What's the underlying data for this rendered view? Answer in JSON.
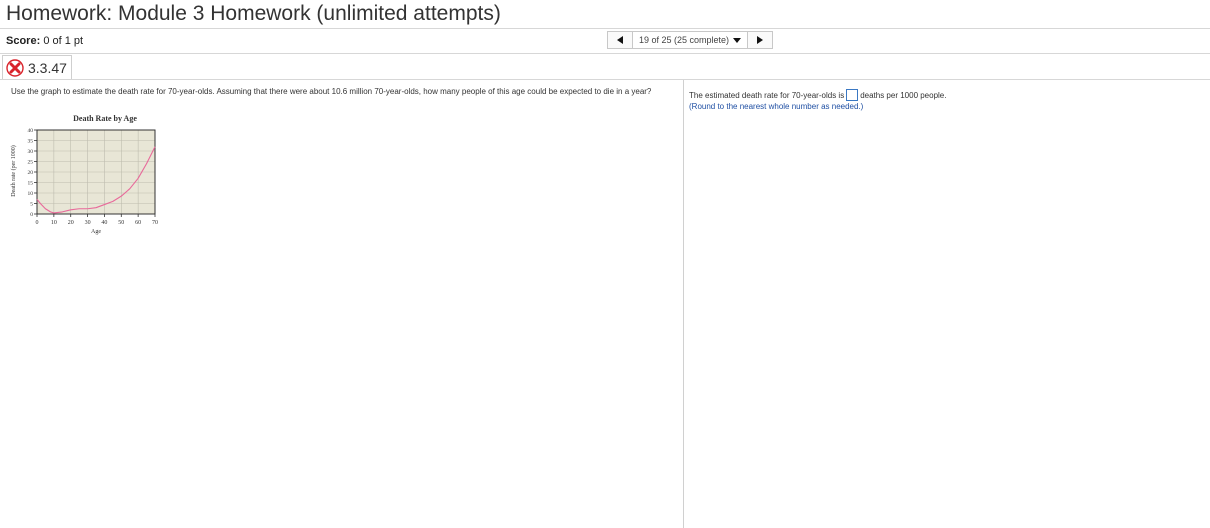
{
  "header": {
    "title": "Homework: Module 3 Homework (unlimited attempts)",
    "score_label": "Score:",
    "score_value": "0 of 1 pt"
  },
  "nav": {
    "position_text": "19 of 25 (25 complete)"
  },
  "question": {
    "number": "3.3.47",
    "status": "incorrect",
    "prompt": "Use the graph to estimate the death rate for 70-year-olds. Assuming that there were about 10.6 million 70-year-olds, how many people of this age could be expected to die in a year?"
  },
  "answer": {
    "before": "The estimated death rate for 70-year-olds is",
    "after": "deaths per 1000 people.",
    "hint": "(Round to the nearest whole number as needed.)",
    "input_value": ""
  },
  "colors": {
    "incorrect_red": "#d9232b",
    "plot_bg": "#e8e6d6",
    "curve": "#e8699a",
    "hint_blue": "#1f4fa3"
  },
  "chart_data": {
    "type": "line",
    "title": "Death Rate by Age",
    "xlabel": "Age",
    "ylabel": "Death rate (per 1000)",
    "xlim": [
      0,
      70
    ],
    "ylim": [
      0,
      40
    ],
    "x_ticks": [
      "0",
      "10",
      "20",
      "30",
      "40",
      "50",
      "60",
      "70"
    ],
    "y_ticks": [
      "0",
      "5",
      "10",
      "15",
      "20",
      "25",
      "30",
      "35",
      "40"
    ],
    "grid": true,
    "x": [
      0,
      2,
      5,
      8,
      10,
      15,
      20,
      25,
      30,
      35,
      40,
      45,
      50,
      55,
      60,
      65,
      70
    ],
    "y": [
      7,
      5,
      2.5,
      1,
      0.5,
      1,
      2,
      2.5,
      2.5,
      3,
      4.5,
      6,
      8.5,
      12,
      17,
      24,
      32
    ]
  }
}
